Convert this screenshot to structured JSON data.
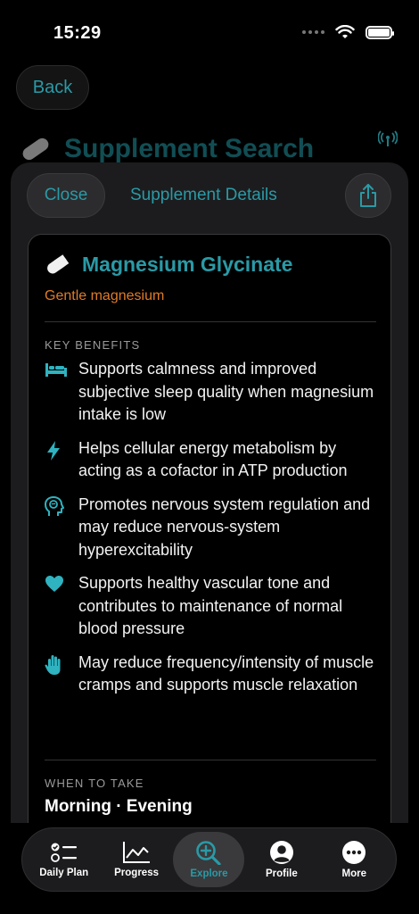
{
  "status_bar": {
    "time": "15:29"
  },
  "nav": {
    "back_label": "Back"
  },
  "background": {
    "title": "Supplement Search"
  },
  "sheet": {
    "close_label": "Close",
    "title": "Supplement Details"
  },
  "supplement": {
    "name": "Magnesium Glycinate",
    "subtitle": "Gentle magnesium",
    "benefits_label": "KEY BENEFITS",
    "benefits": [
      {
        "icon": "bed-icon",
        "text": "Supports calmness and improved subjective sleep quality when magnesium intake is low"
      },
      {
        "icon": "bolt-icon",
        "text": "Helps cellular energy metabolism by acting as a cofactor in ATP production"
      },
      {
        "icon": "brain-head-icon",
        "text": "Promotes nervous system regulation and may reduce nervous-system hyperexcitability"
      },
      {
        "icon": "heart-icon",
        "text": "Supports healthy vascular tone and contributes to maintenance of normal blood pressure"
      },
      {
        "icon": "hand-icon",
        "text": "May reduce frequency/intensity of muscle cramps and supports muscle relaxation"
      }
    ],
    "when_label": "WHEN TO TAKE",
    "when_value": "Morning · Evening"
  },
  "tabs": [
    {
      "label": "Daily Plan",
      "icon": "checklist-icon",
      "active": false
    },
    {
      "label": "Progress",
      "icon": "chart-icon",
      "active": false
    },
    {
      "label": "Explore",
      "icon": "magnifier-plus-icon",
      "active": true
    },
    {
      "label": "Profile",
      "icon": "person-circle-icon",
      "active": false
    },
    {
      "label": "More",
      "icon": "ellipsis-circle-icon",
      "active": false
    }
  ],
  "colors": {
    "accent": "#2a9aa6",
    "orange": "#e07b28",
    "background": "#000000",
    "sheet": "#1c1c1e"
  }
}
